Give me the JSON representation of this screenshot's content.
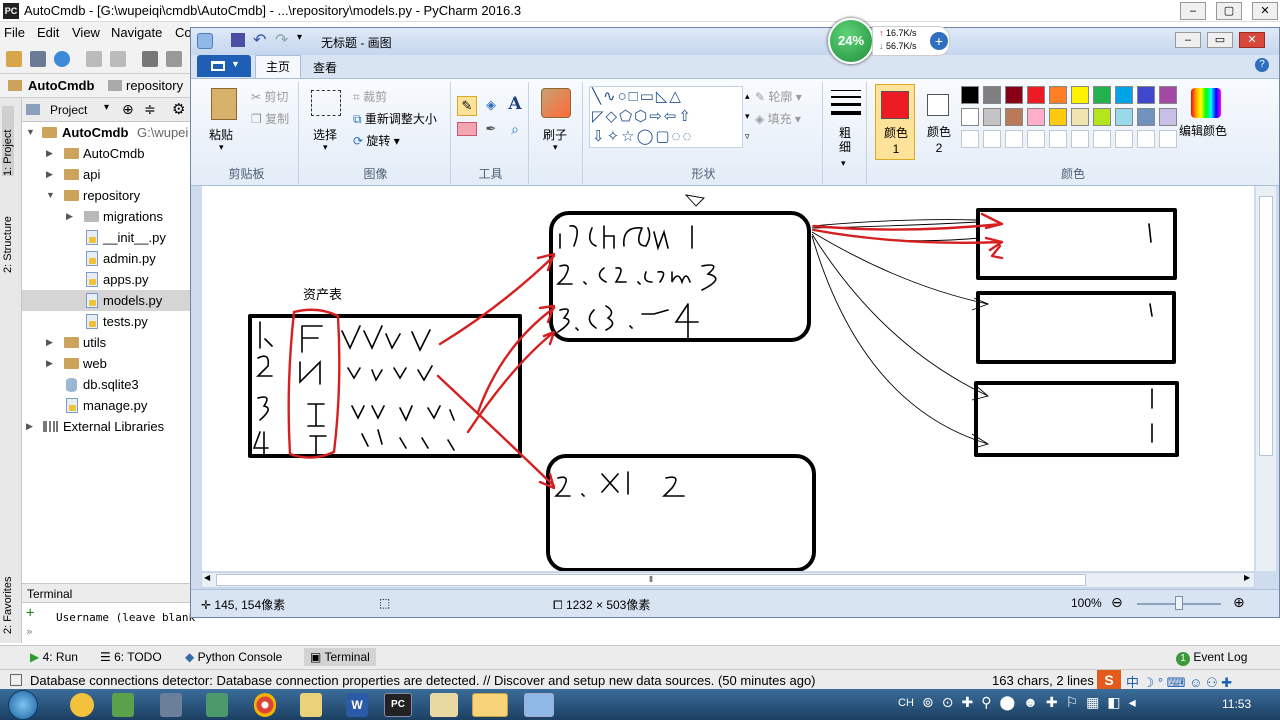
{
  "pycharm": {
    "title": "AutoCmdb - [G:\\wupeiqi\\cmdb\\AutoCmdb] - ...\\repository\\models.py - PyCharm 2016.3",
    "logo": "PC",
    "menu": [
      "File",
      "Edit",
      "View",
      "Navigate",
      "Co"
    ],
    "breadcrumb": [
      "AutoCmdb",
      "repository"
    ],
    "project_label": "Project",
    "side_tabs": [
      "1: Project",
      "2: Structure",
      "2: Favorites"
    ],
    "tree": [
      {
        "label": "AutoCmdb",
        "extra": "G:\\wupei",
        "level": 0,
        "type": "folder",
        "open": true
      },
      {
        "label": "AutoCmdb",
        "level": 1,
        "type": "folder",
        "open": false
      },
      {
        "label": "api",
        "level": 1,
        "type": "folder",
        "open": false
      },
      {
        "label": "repository",
        "level": 1,
        "type": "folder",
        "open": true
      },
      {
        "label": "migrations",
        "level": 2,
        "type": "folder",
        "open": false
      },
      {
        "label": "__init__.py",
        "level": 2,
        "type": "py"
      },
      {
        "label": "admin.py",
        "level": 2,
        "type": "py"
      },
      {
        "label": "apps.py",
        "level": 2,
        "type": "py"
      },
      {
        "label": "models.py",
        "level": 2,
        "type": "py",
        "selected": true
      },
      {
        "label": "tests.py",
        "level": 2,
        "type": "py"
      },
      {
        "label": "utils",
        "level": 1,
        "type": "folder",
        "open": false
      },
      {
        "label": "web",
        "level": 1,
        "type": "folder",
        "open": false
      },
      {
        "label": "db.sqlite3",
        "level": 1,
        "type": "db"
      },
      {
        "label": "manage.py",
        "level": 1,
        "type": "py"
      },
      {
        "label": "External Libraries",
        "level": 0,
        "type": "lib",
        "open": false
      }
    ],
    "terminal_title": "Terminal",
    "terminal_text": "Username (leave blank",
    "bottom_tabs": [
      {
        "label": "4: Run",
        "icon": "run-icon"
      },
      {
        "label": "6: TODO",
        "icon": "todo-icon"
      },
      {
        "label": "Python Console",
        "icon": "python-console-icon"
      },
      {
        "label": "Terminal",
        "icon": "terminal-icon"
      }
    ],
    "event_log": "Event Log",
    "event_log_badge": "1",
    "status_message": "Database connections detector: Database connection properties are detected. // Discover and setup new data sources. (50 minutes ago)",
    "status_right": "163 chars, 2 lines"
  },
  "paint": {
    "title": "无标题 - 画图",
    "tabs": [
      "主页",
      "查看"
    ],
    "groups": {
      "clipboard": {
        "label": "剪贴板",
        "paste": "粘贴",
        "cut": "剪切",
        "copy": "复制"
      },
      "image": {
        "label": "图像",
        "select": "选择",
        "crop": "裁剪",
        "resize": "重新调整大小",
        "rotate": "旋转"
      },
      "tools": {
        "label": "工具"
      },
      "brush": {
        "label": "刷子"
      },
      "shapes": {
        "label": "形状",
        "outline": "轮廓",
        "fill": "填充"
      },
      "size": {
        "label": "粗细"
      },
      "colors": {
        "label": "颜色",
        "color1": "颜色 1",
        "color2": "颜色 2",
        "edit": "编辑颜色"
      }
    },
    "color1": "#ed1c24",
    "color2": "#ffffff",
    "palette_row1": [
      "#000000",
      "#7f7f7f",
      "#880015",
      "#ed1c24",
      "#ff7f27",
      "#fff200",
      "#22b14c",
      "#00a2e8",
      "#3f48cc",
      "#a349a4"
    ],
    "palette_row2": [
      "#ffffff",
      "#c3c3c3",
      "#b97a57",
      "#ffaec9",
      "#ffc90e",
      "#efe4b0",
      "#b5e61d",
      "#99d9ea",
      "#7092be",
      "#c8bfe7"
    ],
    "status": {
      "cursor": "145, 154像素",
      "size": "1232 × 503像素",
      "zoom": "100%"
    }
  },
  "drawing": {
    "label_asset_table": "资产表"
  },
  "speed_widget": {
    "percent": "24%",
    "up": "16.7K/s",
    "down": "56.7K/s"
  },
  "taskbar": {
    "time": "11:53",
    "lang": "CH"
  }
}
